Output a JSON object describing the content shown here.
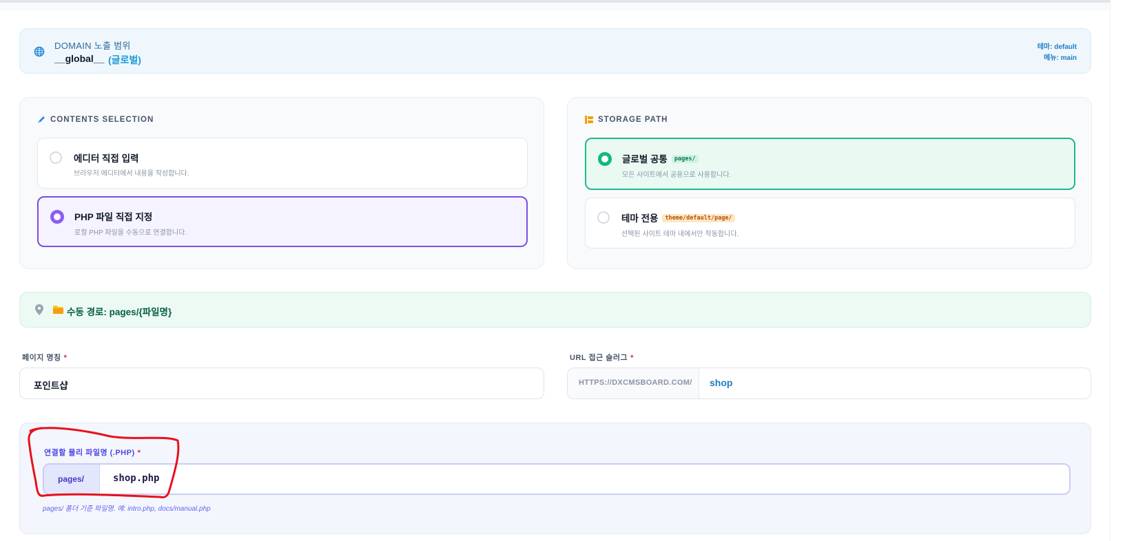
{
  "domain": {
    "label": "DOMAIN 노출 범위",
    "value": "__global__",
    "value_sub": "(글로벌)",
    "theme": "테마: default",
    "menu": "메뉴: main"
  },
  "contents_selection": {
    "title": "CONTENTS SELECTION",
    "options": [
      {
        "title": "에디터 직접 입력",
        "desc": "브라우저 에디터에서 내용을 작성합니다.",
        "selected": false
      },
      {
        "title": "PHP 파일 직접 지정",
        "desc": "로컬 PHP 파일을 수동으로 연결합니다.",
        "selected": true
      }
    ]
  },
  "storage_path": {
    "title": "STORAGE PATH",
    "options": [
      {
        "title": "글로벌 공통",
        "tag": "pages/",
        "desc": "모든 사이트에서 공용으로 사용합니다.",
        "selected": true
      },
      {
        "title": "테마 전용",
        "tag": "theme/default/page/",
        "desc": "선택된 사이트 테마 내에서만 작동합니다.",
        "selected": false
      }
    ]
  },
  "manual_path": {
    "text": "수동 경로: pages/{파일명}"
  },
  "page_name": {
    "label": "페이지 명칭",
    "required": "*",
    "value": "포인트샵"
  },
  "slug": {
    "label": "URL 접근 슬러그",
    "required": "*",
    "prefix": "HTTPS://DXCMSBOARD.COM/",
    "value": "shop"
  },
  "physical_file": {
    "label": "연결할 물리 파일명 (.PHP)",
    "required": "*",
    "prefix": "pages/",
    "value": "shop.php",
    "hint": "pages/ 폴더 기준 파일명. 예: intro.php, docs/manual.php"
  },
  "colors": {
    "accent_purple": "#7c4ddf",
    "accent_green": "#1eb88a",
    "accent_blue": "#1c7fc0",
    "annotation_red": "#e8101a"
  }
}
